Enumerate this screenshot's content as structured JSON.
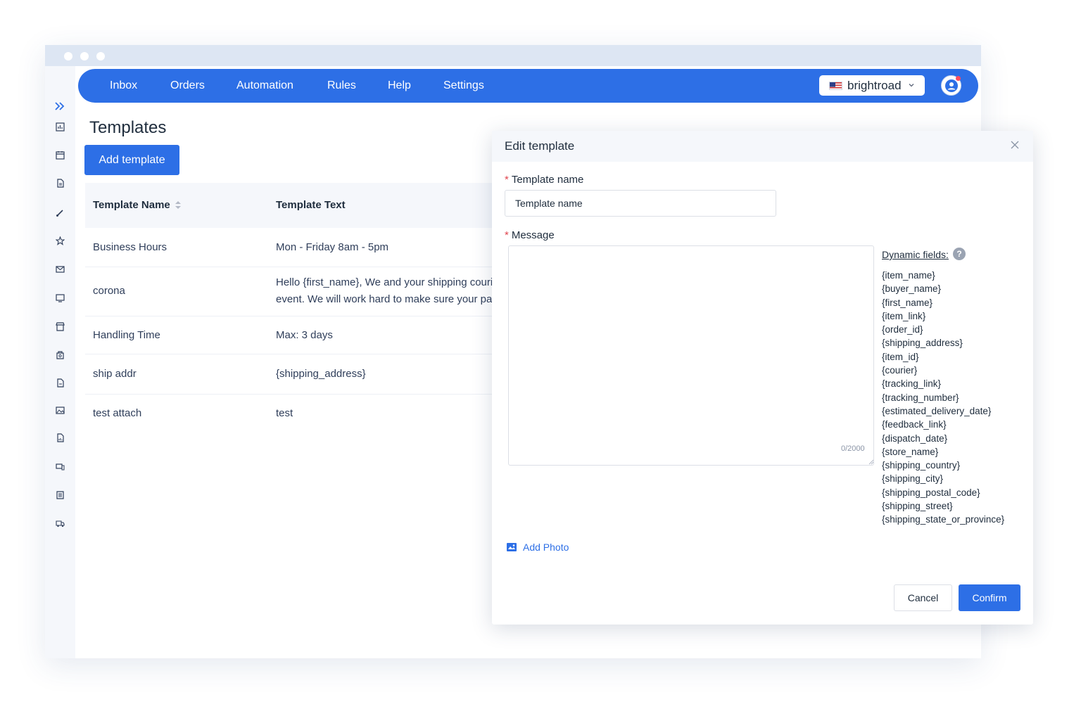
{
  "nav": {
    "items": [
      "Inbox",
      "Orders",
      "Automation",
      "Rules",
      "Help",
      "Settings"
    ],
    "store": "brightroad"
  },
  "page": {
    "title": "Templates",
    "add_button": "Add template"
  },
  "table": {
    "headers": [
      "Template Name",
      "Template Text"
    ],
    "rows": [
      {
        "name": "Business Hours",
        "text": [
          "Mon - Friday 8am - 5pm"
        ]
      },
      {
        "name": "corona",
        "text": [
          "Hello {first_name}, We and your shipping couri",
          "event. We will work hard to make sure your pa"
        ]
      },
      {
        "name": "Handling Time",
        "text": [
          "Max: 3 days"
        ]
      },
      {
        "name": "ship addr",
        "text": [
          "{shipping_address}"
        ]
      },
      {
        "name": "test attach",
        "text": [
          "test"
        ]
      }
    ]
  },
  "modal": {
    "title": "Edit template",
    "name_label": "Template name",
    "name_placeholder": "Template name",
    "message_label": "Message",
    "counter": "0/2000",
    "dynamic_title": "Dynamic fields:",
    "help": "?",
    "dynamic_fields": [
      "{item_name}",
      "{buyer_name}",
      "{first_name}",
      "{item_link}",
      "{order_id}",
      "{shipping_address}",
      "{item_id}",
      "{courier}",
      "{tracking_link}",
      "{tracking_number}",
      "{estimated_delivery_date}",
      "{feedback_link}",
      "{dispatch_date}",
      "{store_name}",
      "{shipping_country}",
      "{shipping_city}",
      "{shipping_postal_code}",
      "{shipping_street}",
      "{shipping_state_or_province}"
    ],
    "add_photo": "Add Photo",
    "cancel": "Cancel",
    "confirm": "Confirm"
  },
  "colors": {
    "accent": "#2d6fe6",
    "required": "#e0454f",
    "header_bg": "#f5f7fb"
  }
}
